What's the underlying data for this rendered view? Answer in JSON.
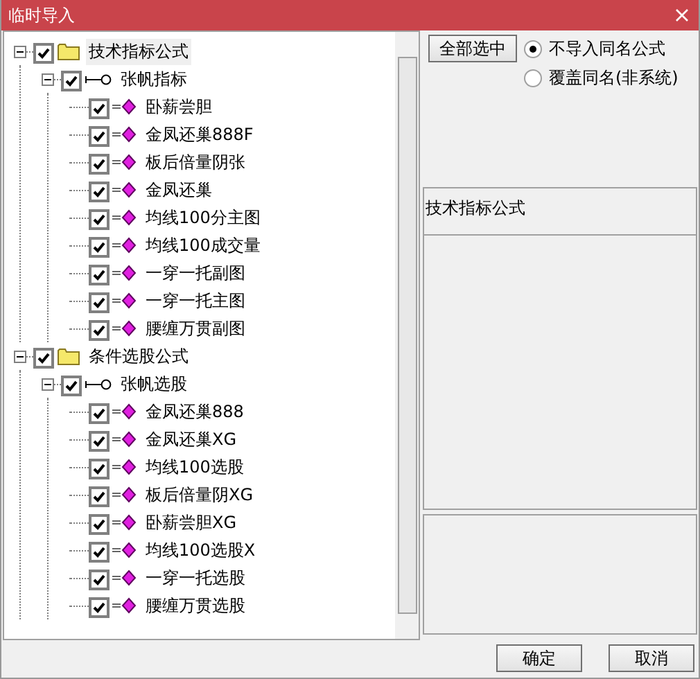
{
  "window": {
    "title": "临时导入"
  },
  "tree": [
    {
      "kind": "folder",
      "label": "技术指标公式",
      "checked": true,
      "expanded": true,
      "selected": true,
      "children": [
        {
          "kind": "group",
          "label": "张帆指标",
          "checked": true,
          "expanded": true,
          "selected": false,
          "children": [
            {
              "kind": "formula",
              "label": "卧薪尝胆",
              "checked": true,
              "selected": false
            },
            {
              "kind": "formula",
              "label": "金凤还巢888F",
              "checked": true,
              "selected": false
            },
            {
              "kind": "formula",
              "label": "板后倍量阴张",
              "checked": true,
              "selected": false
            },
            {
              "kind": "formula",
              "label": "金凤还巢",
              "checked": true,
              "selected": false
            },
            {
              "kind": "formula",
              "label": "均线100分主图",
              "checked": true,
              "selected": false
            },
            {
              "kind": "formula",
              "label": "均线100成交量",
              "checked": true,
              "selected": false
            },
            {
              "kind": "formula",
              "label": "一穿一托副图",
              "checked": true,
              "selected": false
            },
            {
              "kind": "formula",
              "label": "一穿一托主图",
              "checked": true,
              "selected": false
            },
            {
              "kind": "formula",
              "label": "腰缠万贯副图",
              "checked": true,
              "selected": false
            }
          ]
        }
      ]
    },
    {
      "kind": "folder",
      "label": "条件选股公式",
      "checked": true,
      "expanded": true,
      "selected": false,
      "children": [
        {
          "kind": "group",
          "label": "张帆选股",
          "checked": true,
          "expanded": true,
          "selected": false,
          "children": [
            {
              "kind": "formula",
              "label": "金凤还巢888",
              "checked": true,
              "selected": false
            },
            {
              "kind": "formula",
              "label": "金凤还巢XG",
              "checked": true,
              "selected": false
            },
            {
              "kind": "formula",
              "label": "均线100选股",
              "checked": true,
              "selected": false
            },
            {
              "kind": "formula",
              "label": "板后倍量阴XG",
              "checked": true,
              "selected": false
            },
            {
              "kind": "formula",
              "label": "卧薪尝胆XG",
              "checked": true,
              "selected": false
            },
            {
              "kind": "formula",
              "label": "均线100选股X",
              "checked": true,
              "selected": false
            },
            {
              "kind": "formula",
              "label": "一穿一托选股",
              "checked": true,
              "selected": false
            },
            {
              "kind": "formula",
              "label": "腰缠万贯选股",
              "checked": true,
              "selected": false
            }
          ]
        }
      ]
    }
  ],
  "select_all_button": "全部选中",
  "options": [
    {
      "label": "不导入同名公式",
      "selected": true
    },
    {
      "label": "覆盖同名(非系统)",
      "selected": false
    }
  ],
  "info_panel": {
    "text": "技术指标公式"
  },
  "buttons": [
    "确定",
    "取消"
  ]
}
